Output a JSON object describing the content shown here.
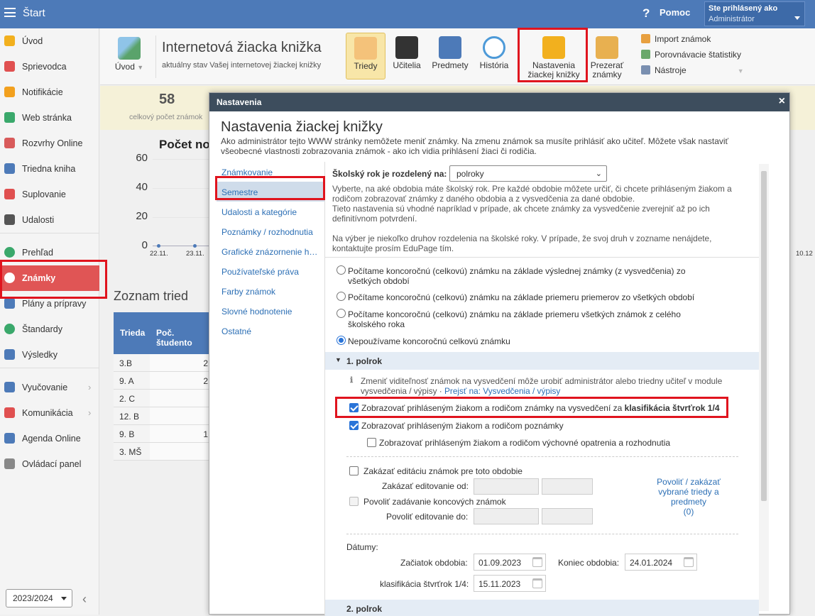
{
  "topbar": {
    "start": "Štart",
    "help": "?",
    "pomoc": "Pomoc",
    "logged_as": "Ste prihlásený ako",
    "role": "Administrátor"
  },
  "sidebar": {
    "items": [
      {
        "label": "Úvod",
        "icon": "star-icon",
        "color": "#f2b01e"
      },
      {
        "label": "Sprievodca",
        "icon": "wand-icon",
        "color": "#e05050"
      },
      {
        "label": "Notifikácie",
        "icon": "envelope-icon",
        "color": "#f2a01e"
      },
      {
        "label": "Web stránka",
        "icon": "house-icon",
        "color": "#3aa86b"
      },
      {
        "label": "Rozvrhy Online",
        "icon": "grid-icon",
        "color": "#d85a5a"
      },
      {
        "label": "Triedna kniha",
        "icon": "book-icon",
        "color": "#4d7ab8"
      },
      {
        "label": "Suplovanie",
        "icon": "person-icon",
        "color": "#e05050"
      },
      {
        "label": "Udalosti",
        "icon": "calendar-icon",
        "color": "#555"
      },
      {
        "label": "Prehľad",
        "icon": "check-icon",
        "color": "#3aa86b"
      },
      {
        "label": "Známky",
        "icon": "grade-icon",
        "color": "#e05050"
      },
      {
        "label": "Plány a prípravy",
        "icon": "plans-icon",
        "color": "#4d7ab8"
      },
      {
        "label": "Štandardy",
        "icon": "shield-icon",
        "color": "#3aa86b"
      },
      {
        "label": "Výsledky",
        "icon": "bar-chart-icon",
        "color": "#4d7ab8"
      },
      {
        "label": "Vyučovanie",
        "icon": "teaching-icon",
        "color": "#4d7ab8"
      },
      {
        "label": "Komunikácia",
        "icon": "chat-icon",
        "color": "#e05050"
      },
      {
        "label": "Agenda Online",
        "icon": "pen-icon",
        "color": "#4d7ab8"
      },
      {
        "label": "Ovládací panel",
        "icon": "gear-icon",
        "color": "#888"
      }
    ],
    "year": "2023/2024",
    "collapse": "‹"
  },
  "ribbon": {
    "home": "Úvod",
    "title": "Internetová žiacka knižka",
    "subtitle": "aktuálny stav Vašej internetovej žiackej knižky",
    "buttons": [
      {
        "label": "Triedy"
      },
      {
        "label": "Učitelia"
      },
      {
        "label": "Predmety"
      },
      {
        "label": "História"
      },
      {
        "label": "Nastavenia\nžiackej knižky"
      },
      {
        "label": "Prezerať\nznámky"
      }
    ],
    "small": [
      {
        "label": "Import známok"
      },
      {
        "label": "Porovnávacie štatistiky"
      },
      {
        "label": "Nástroje"
      }
    ]
  },
  "background": {
    "stat_value": "58",
    "stat_label": "celkový počet známok",
    "chart_title": "Počet nov",
    "yticks": [
      "60",
      "40",
      "20",
      "0"
    ],
    "xticks": [
      "22.11.",
      "23.11.",
      "10.12"
    ],
    "list_title": "Zoznam tried",
    "table_headers": [
      "Trieda",
      "Poč. študento"
    ],
    "table_rows": [
      {
        "c1": "3.B",
        "c2": "2"
      },
      {
        "c1": "9. A",
        "c2": "2"
      },
      {
        "c1": "2. C",
        "c2": ""
      },
      {
        "c1": "12. B",
        "c2": ""
      },
      {
        "c1": "9. B",
        "c2": "1"
      },
      {
        "c1": "3. MŠ",
        "c2": ""
      }
    ]
  },
  "dialog": {
    "bar_title": "Nastavenia",
    "close": "×",
    "title": "Nastavenia žiackej knižky",
    "desc": "Ako administrátor tejto WWW stránky nemôžete meniť známky. Na zmenu známok sa musíte prihlásiť ako učiteľ. Môžete však nastaviť všeobecné vlastnosti zobrazovania známok - ako ich vidia prihlásení žiaci či rodičia.",
    "nav": [
      "Známkovanie",
      "Semestre",
      "Udalosti a kategórie",
      "Poznámky / rozhodnutia",
      "Grafické znázornenie h…",
      "Používateľské práva",
      "Farby známok",
      "Slovné hodnotenie",
      "Ostatné"
    ],
    "school_year_label": "Školský rok je rozdelený na:",
    "school_year_value": "polroky",
    "info1": "Vyberte, na aké obdobia máte školský rok. Pre každé obdobie môžete určiť, či chcete prihláseným žiakom a rodičom zobrazovať známky z daného obdobia a z vysvedčenia za dané obdobie.",
    "info2": "Tieto nastavenia sú vhodné napríklad v prípade, ak chcete známky za vysvedčenie zverejniť až po ich definitívnom potvrdení.",
    "info3": "Na výber je niekoľko druhov rozdelenia na školské roky. V prípade, že svoj druh v zozname nenájdete, kontaktujte prosím EduPage tím.",
    "radios": [
      "Počítame koncoročnú (celkovú) známku na základe výslednej známky (z vysvedčenia) zo všetkých období",
      "Počítame koncoročnú (celkovú) známku na základe priemeru priemerov zo všetkých období",
      "Počítame koncoročnú (celkovú) známku na základe priemeru všetkých známok z celého školského roka",
      "Nepoužívame koncoročnú celkovú známku"
    ],
    "section": "1. polrok",
    "notice": "Zmeniť viditeľnosť známok na vysvedčení môže urobiť administrátor alebo triedny učiteľ v module vysvedčenia / výpisy",
    "notice_link": "Prejsť na: Vysvedčenia / výpisy",
    "cb1_pre": "Zobrazovať prihláseným žiakom a rodičom známky na vysvedčení za ",
    "cb1_bold": "klasifikácia štvrťrok 1/4",
    "cb2": "Zobrazovať prihláseným žiakom a rodičom poznámky",
    "cb3": "Zobrazovať prihláseným žiakom a rodičom výchovné opatrenia a rozhodnutia",
    "cb4": "Zakázať editáciu známok pre toto obdobie",
    "lock_from": "Zakázať editovanie od:",
    "cb5": "Povoliť zadávanie koncových známok",
    "allow_until": "Povoliť editovanie do:",
    "side_link": "Povoliť / zakázať vybrané triedy a predmety",
    "side_count": "(0)",
    "dates_label": "Dátumy:",
    "start_label": "Začiatok obdobia:",
    "start_value": "01.09.2023",
    "end_label": "Koniec obdobia:",
    "end_value": "24.01.2024",
    "q_label": "klasifikácia štvrťrok 1/4:",
    "q_value": "15.11.2023",
    "next_section": "2. polrok"
  },
  "colors": {
    "accent": "#4d7ab8",
    "active": "#e05555",
    "highlight": "#e0141e",
    "dialog_bar": "#3d4d5d",
    "link": "#2c6fb5"
  }
}
